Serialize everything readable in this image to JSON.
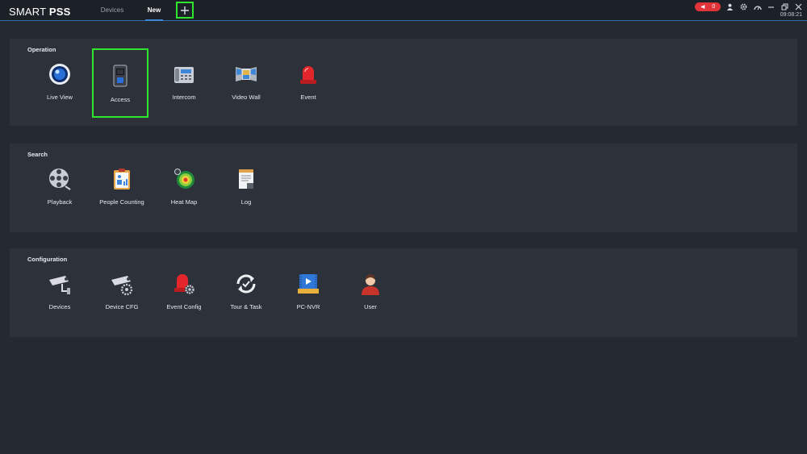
{
  "app": {
    "logo_light": "SMART ",
    "logo_bold": "PSS"
  },
  "tabs": [
    {
      "label": "Devices"
    },
    {
      "label": "New"
    }
  ],
  "tray": {
    "alarm_count": "0",
    "clock": "09:08:21"
  },
  "sections": [
    {
      "title": "Operation",
      "items": [
        {
          "label": "Live View",
          "icon": "live-view-icon"
        },
        {
          "label": "Access",
          "icon": "access-icon"
        },
        {
          "label": "Intercom",
          "icon": "intercom-icon"
        },
        {
          "label": "Video Wall",
          "icon": "video-wall-icon"
        },
        {
          "label": "Event",
          "icon": "event-icon"
        }
      ]
    },
    {
      "title": "Search",
      "items": [
        {
          "label": "Playback",
          "icon": "playback-icon"
        },
        {
          "label": "People Counting",
          "icon": "people-counting-icon"
        },
        {
          "label": "Heat Map",
          "icon": "heat-map-icon"
        },
        {
          "label": "Log",
          "icon": "log-icon"
        }
      ]
    },
    {
      "title": "Configuration",
      "items": [
        {
          "label": "Devices",
          "icon": "devices-icon"
        },
        {
          "label": "Device CFG",
          "icon": "device-cfg-icon"
        },
        {
          "label": "Event Config",
          "icon": "event-config-icon"
        },
        {
          "label": "Tour & Task",
          "icon": "tour-task-icon"
        },
        {
          "label": "PC-NVR",
          "icon": "pc-nvr-icon"
        },
        {
          "label": "User",
          "icon": "user-icon"
        }
      ]
    }
  ],
  "colors": {
    "background": "#252a32",
    "panel": "#2c313a",
    "accent": "#3d86d8",
    "highlight": "#2ee62e",
    "alarm": "#e0343a"
  }
}
